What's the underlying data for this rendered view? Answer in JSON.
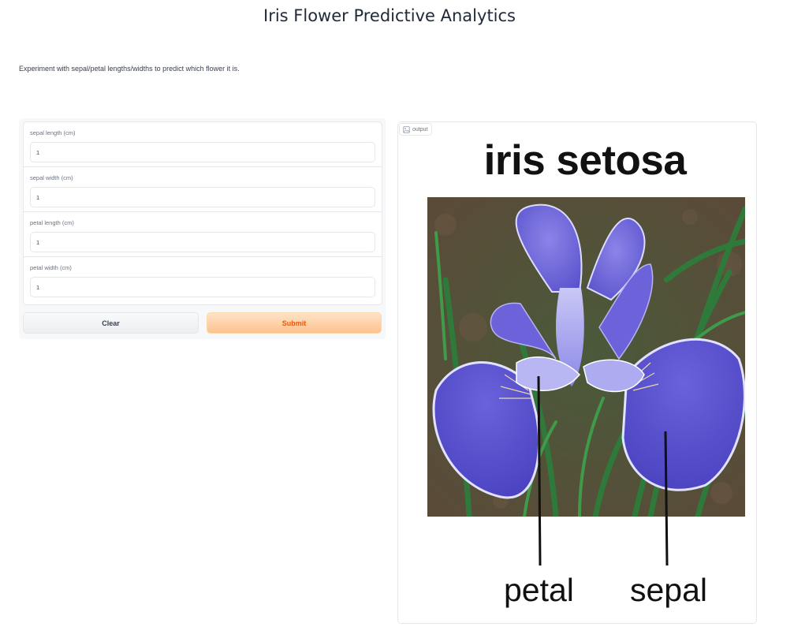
{
  "header": {
    "title": "Iris Flower Predictive Analytics"
  },
  "description": "Experiment with sepal/petal lengths/widths to predict which flower it is.",
  "form": {
    "fields": [
      {
        "label": "sepal length (cm)",
        "value": "1"
      },
      {
        "label": "sepal width (cm)",
        "value": "1"
      },
      {
        "label": "petal length (cm)",
        "value": "1"
      },
      {
        "label": "petal width (cm)",
        "value": "1"
      }
    ],
    "clear_label": "Clear",
    "submit_label": "Submit"
  },
  "output": {
    "tag_label": "output",
    "image": {
      "title": "iris setosa",
      "petal_label": "petal",
      "sepal_label": "sepal"
    }
  },
  "colors": {
    "submit_text": "#ea580c",
    "submit_bg": "#fdc28d",
    "petal_purple": "#6f64d8",
    "sepal_purple": "#5a55d0"
  }
}
